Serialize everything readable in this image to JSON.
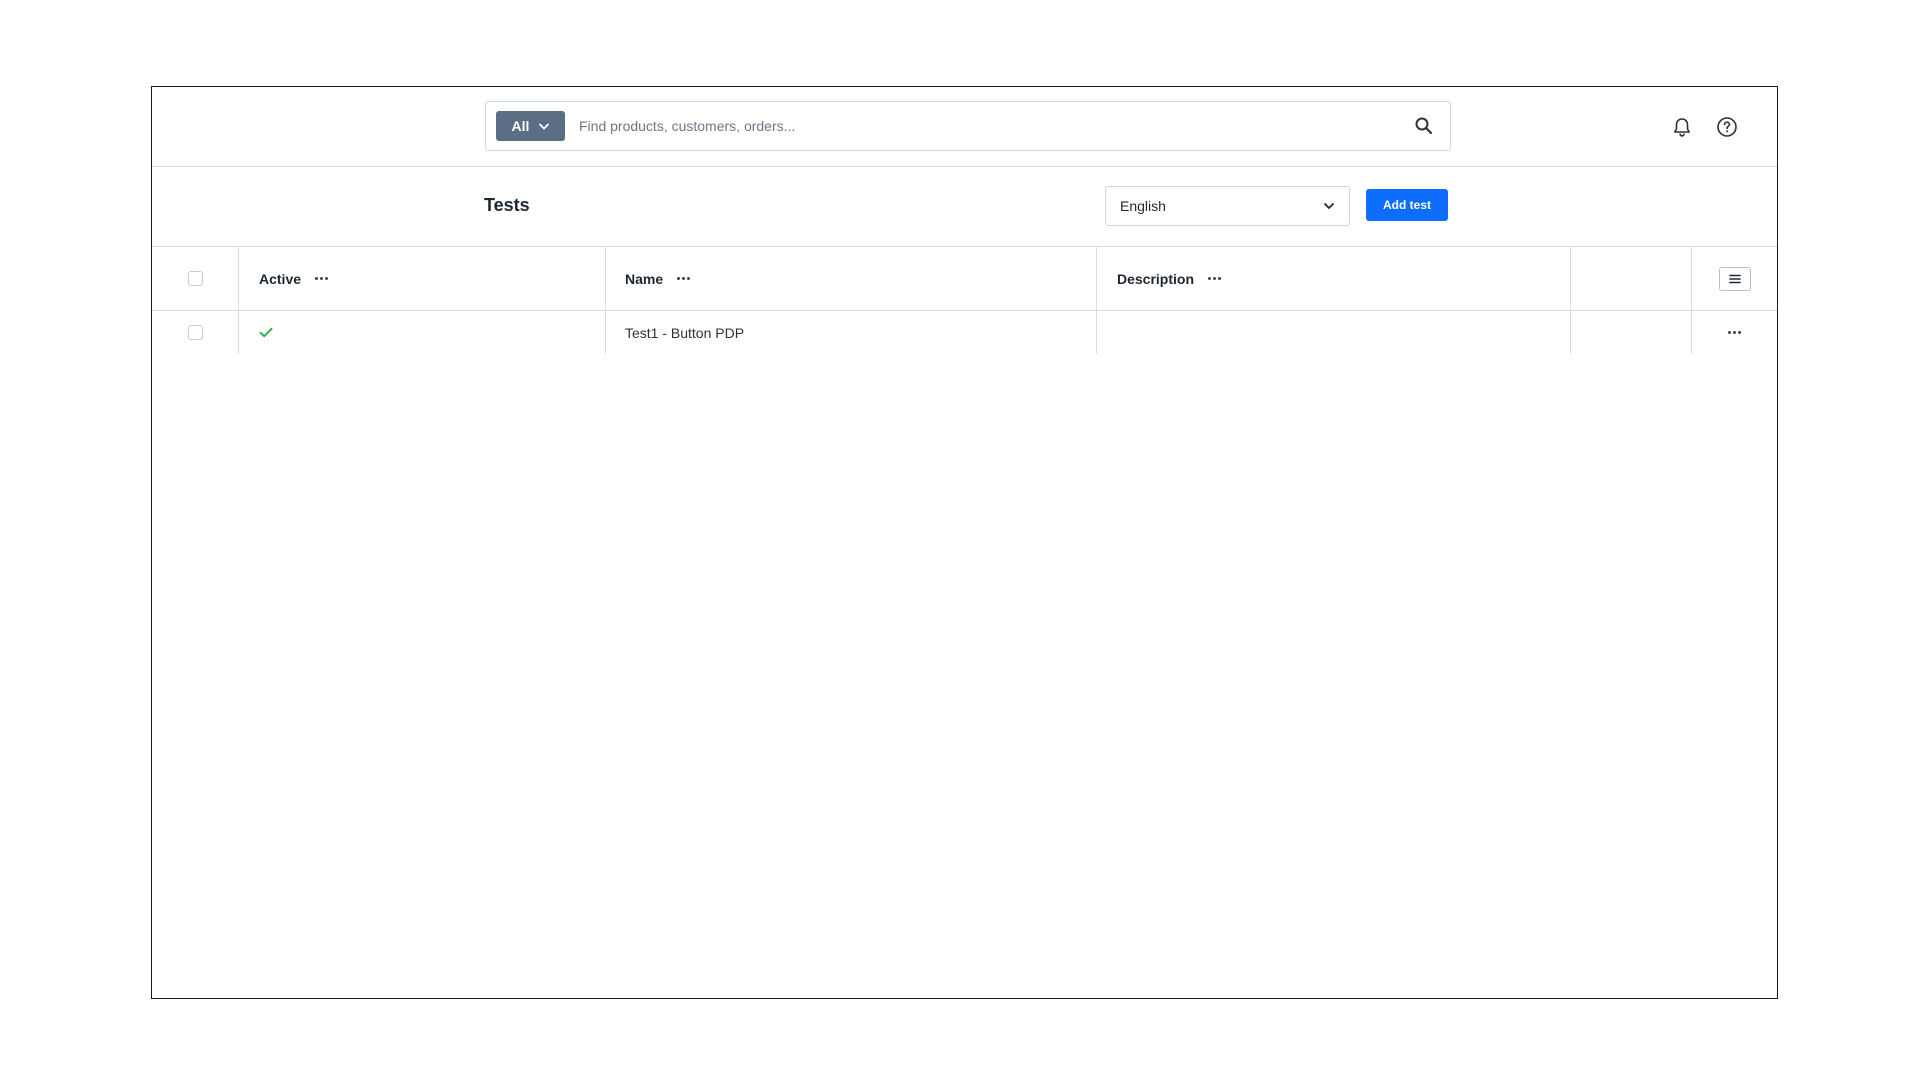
{
  "search": {
    "scope_label": "All",
    "placeholder": "Find products, customers, orders..."
  },
  "icons": {
    "search": "search-icon",
    "bell": "bell-icon",
    "help": "help-icon",
    "chevron": "chevron-down-icon",
    "check": "check-icon",
    "more": "more-horizontal-icon",
    "columns": "list-columns-icon"
  },
  "header": {
    "title": "Tests",
    "language_selected": "English",
    "add_button_label": "Add test"
  },
  "table": {
    "columns": [
      "Active",
      "Name",
      "Description"
    ],
    "rows": [
      {
        "active": true,
        "name": "Test1 - Button PDP",
        "description": ""
      }
    ]
  },
  "colors": {
    "primary": "#0d6efd",
    "scope_button": "#5a6f85",
    "active_check": "#2bb24c",
    "border": "#d8dde3"
  }
}
